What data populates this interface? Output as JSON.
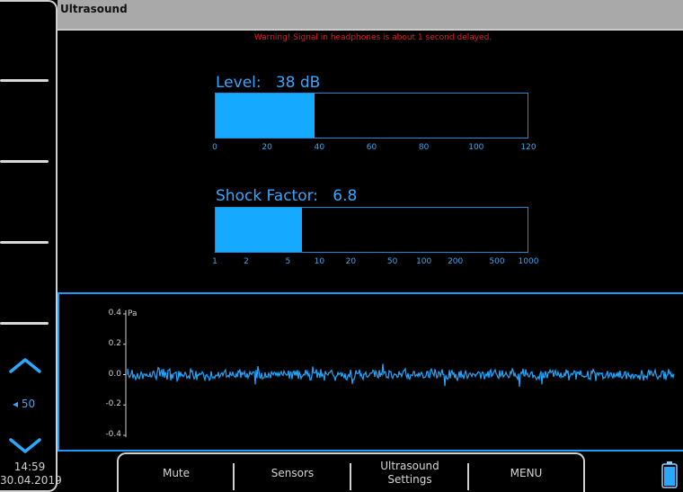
{
  "window": {
    "title": "Ultrasound"
  },
  "warning": "Warning! Signal in headphones is about 1 second delayed.",
  "level": {
    "label": "Level:",
    "value_text": "38 dB",
    "value": 38,
    "scale_min": 0,
    "scale_max": 120,
    "ticks": [
      "0",
      "20",
      "40",
      "60",
      "80",
      "100",
      "120"
    ]
  },
  "shock": {
    "label": "Shock Factor:",
    "value_text": "6.8",
    "value": 6.8,
    "scale": "log",
    "scale_min": 1,
    "scale_max": 1000,
    "ticks": [
      "1",
      "2",
      "5",
      "10",
      "20",
      "50",
      "100",
      "200",
      "500",
      "1000"
    ]
  },
  "waveform": {
    "unit": "Pa",
    "y_ticks": [
      "0.4",
      "0.2",
      "0.0",
      "-0.2",
      "-0.4"
    ],
    "ylim": [
      -0.4,
      0.4
    ],
    "color": "#1ea6ff"
  },
  "sidebar": {
    "up_icon": "chevron-up-icon",
    "down_icon": "chevron-down-icon",
    "step_text": "◂ 50"
  },
  "status": {
    "time": "14:59",
    "date": "30.04.2019"
  },
  "menu": {
    "mute": "Mute",
    "sensors": "Sensors",
    "ultrasound_settings_line1": "Ultrasound",
    "ultrasound_settings_line2": "Settings",
    "menu": "MENU"
  },
  "colors": {
    "accent": "#15aaff",
    "warning": "#e02020",
    "titlebar": "#a9a9a9"
  },
  "battery_icon": "battery-icon"
}
